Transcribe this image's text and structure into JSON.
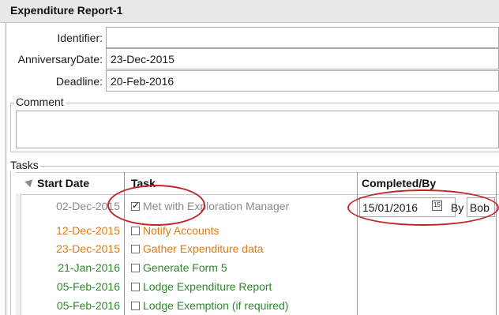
{
  "window": {
    "title": "Expenditure Report-1"
  },
  "fields": {
    "identifier": {
      "label": "Identifier:",
      "value": ""
    },
    "anniversary": {
      "label": "AnniversaryDate:",
      "value": "23-Dec-2015"
    },
    "deadline": {
      "label": "Deadline:",
      "value": "20-Feb-2016"
    }
  },
  "comment": {
    "label": "Comment",
    "value": ""
  },
  "tasks": {
    "label": "Tasks",
    "columns": {
      "start_date": "Start Date",
      "task": "Task",
      "completed_by": "Completed/By"
    },
    "rows": [
      {
        "date": "02-Dec-2015",
        "task": "Met with Exploration Manager",
        "checked": true,
        "status": "completed",
        "completed_date": "15/01/2016",
        "by_label": "By",
        "by": "Bob"
      },
      {
        "date": "12-Dec-2015",
        "task": "Notify Accounts",
        "checked": false,
        "status": "overdue"
      },
      {
        "date": "23-Dec-2015",
        "task": "Gather Expenditure data",
        "checked": false,
        "status": "overdue"
      },
      {
        "date": "21-Jan-2016",
        "task": "Generate Form 5",
        "checked": false,
        "status": "upcoming"
      },
      {
        "date": "05-Feb-2016",
        "task": "Lodge Expenditure Report",
        "checked": false,
        "status": "upcoming"
      },
      {
        "date": "05-Feb-2016",
        "task": "Lodge Exemption (if required)",
        "checked": false,
        "status": "upcoming"
      }
    ],
    "calendar_icon_text": "15"
  },
  "colors": {
    "completed": "#8a8a8a",
    "overdue": "#e07a10",
    "upcoming": "#2a8a28",
    "annotation": "#c0282c"
  }
}
